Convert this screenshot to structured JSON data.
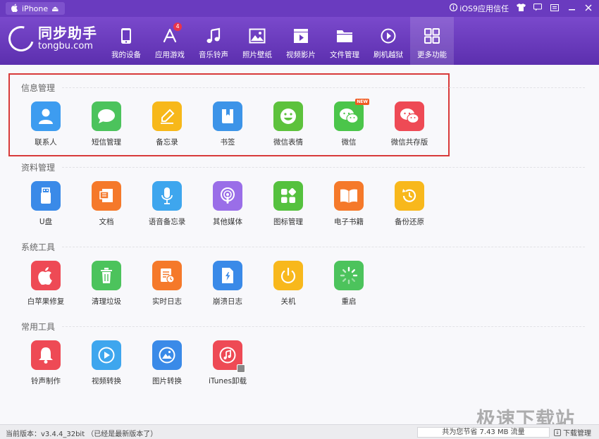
{
  "titlebar": {
    "device_label": "iPhone",
    "eject_glyph": "⏏",
    "trust_label": "iOS9应用信任",
    "buttons": [
      "shirt-icon",
      "chat-icon",
      "menu-icon",
      "minimize-icon",
      "close-icon"
    ]
  },
  "logo": {
    "cn": "同步助手",
    "en": "tongbu.com"
  },
  "nav": [
    {
      "label": "我的设备",
      "icon": "phone-icon"
    },
    {
      "label": "应用游戏",
      "icon": "app-store-icon",
      "badge": "4"
    },
    {
      "label": "音乐铃声",
      "icon": "music-note-icon"
    },
    {
      "label": "照片壁纸",
      "icon": "photo-icon"
    },
    {
      "label": "视频影片",
      "icon": "film-icon"
    },
    {
      "label": "文件管理",
      "icon": "folder-icon"
    },
    {
      "label": "刷机越狱",
      "icon": "flash-icon"
    },
    {
      "label": "更多功能",
      "icon": "grid-icon",
      "active": true
    }
  ],
  "sections": [
    {
      "title": "信息管理",
      "items": [
        {
          "label": "联系人",
          "icon": "contact-icon",
          "color": "#3d9cf0"
        },
        {
          "label": "短信管理",
          "icon": "message-icon",
          "color": "#4cc35c"
        },
        {
          "label": "备忘录",
          "icon": "memo-icon",
          "color": "#f7b81a"
        },
        {
          "label": "书签",
          "icon": "bookmark-icon",
          "color": "#3d94e8"
        },
        {
          "label": "微信表情",
          "icon": "smiley-icon",
          "color": "#5dc23c"
        },
        {
          "label": "微信",
          "icon": "wechat-icon",
          "color": "#4bc54a",
          "badge": "NEW"
        },
        {
          "label": "微信共存版",
          "icon": "wechat-dual-icon",
          "color": "#ee4a55"
        }
      ]
    },
    {
      "title": "资料管理",
      "items": [
        {
          "label": "U盘",
          "icon": "usb-icon",
          "color": "#3a8ae8"
        },
        {
          "label": "文档",
          "icon": "document-icon",
          "color": "#f5792a"
        },
        {
          "label": "语音备忘录",
          "icon": "microphone-icon",
          "color": "#3ea6ee"
        },
        {
          "label": "其他媒体",
          "icon": "podcast-icon",
          "color": "#9a6ee8"
        },
        {
          "label": "图标管理",
          "icon": "icon-grid-icon",
          "color": "#55c13e"
        },
        {
          "label": "电子书籍",
          "icon": "book-icon",
          "color": "#f5792a"
        },
        {
          "label": "备份还原",
          "icon": "restore-icon",
          "color": "#f8b81c"
        }
      ]
    },
    {
      "title": "系统工具",
      "items": [
        {
          "label": "白苹果修复",
          "icon": "apple-repair-icon",
          "color": "#ee4a55"
        },
        {
          "label": "清理垃圾",
          "icon": "trash-icon",
          "color": "#4cc35c"
        },
        {
          "label": "实时日志",
          "icon": "realtime-log-icon",
          "color": "#f5792a"
        },
        {
          "label": "崩溃日志",
          "icon": "crash-log-icon",
          "color": "#3a8ae8"
        },
        {
          "label": "关机",
          "icon": "power-icon",
          "color": "#f8b81c"
        },
        {
          "label": "重启",
          "icon": "restart-icon",
          "color": "#4cc35c"
        }
      ]
    },
    {
      "title": "常用工具",
      "items": [
        {
          "label": "铃声制作",
          "icon": "bell-icon",
          "color": "#ee4a55"
        },
        {
          "label": "视频转换",
          "icon": "video-play-icon",
          "color": "#3ea6ee"
        },
        {
          "label": "图片转换",
          "icon": "image-convert-icon",
          "color": "#3a8ae8"
        },
        {
          "label": "iTunes卸载",
          "icon": "itunes-icon",
          "color": "#ee4a55"
        }
      ]
    }
  ],
  "status": {
    "version": "当前版本：v3.4.4_32bit （已经是最新版本了）",
    "traffic": "共为您节省  7.43 MB 流量",
    "download_manager": "下载管理"
  },
  "watermark": "极速下载站"
}
